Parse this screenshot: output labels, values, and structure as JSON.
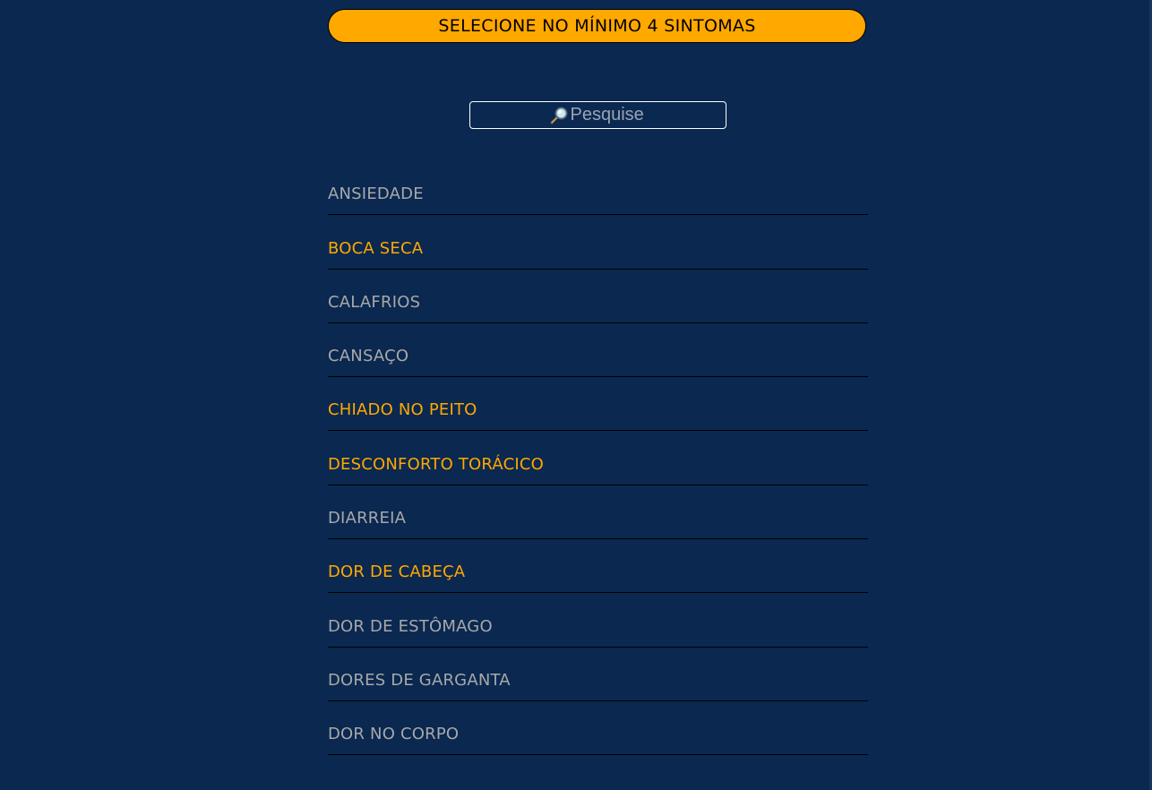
{
  "banner": {
    "text": "SELECIONE NO MÍNIMO 4 SINTOMAS"
  },
  "search": {
    "placeholder": "Pesquise",
    "icon": "magnifier-icon"
  },
  "colors": {
    "background": "#0a2850",
    "accent": "#ffa800",
    "unselected_text": "#a8a8a8",
    "divider": "#000000"
  },
  "symptoms": [
    {
      "label": "ANSIEDADE",
      "selected": false
    },
    {
      "label": "BOCA SECA",
      "selected": true
    },
    {
      "label": "CALAFRIOS",
      "selected": false
    },
    {
      "label": "CANSAÇO",
      "selected": false
    },
    {
      "label": "CHIADO NO PEITO",
      "selected": true
    },
    {
      "label": "DESCONFORTO TORÁCICO",
      "selected": true
    },
    {
      "label": "DIARREIA",
      "selected": false
    },
    {
      "label": "DOR DE CABEÇA",
      "selected": true
    },
    {
      "label": "DOR DE ESTÔMAGO",
      "selected": false
    },
    {
      "label": "DORES DE GARGANTA",
      "selected": false
    },
    {
      "label": "DOR NO CORPO",
      "selected": false
    }
  ]
}
